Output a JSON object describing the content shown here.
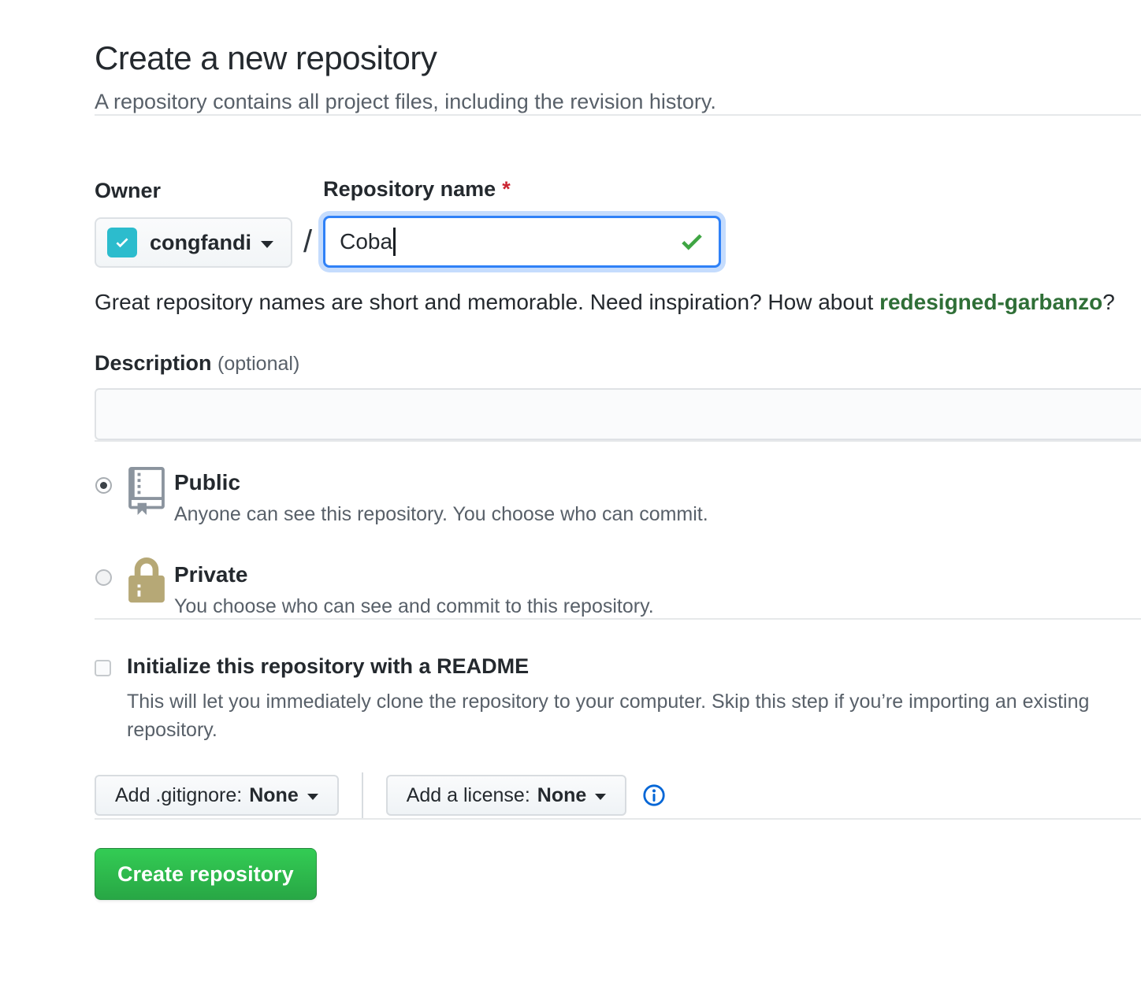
{
  "page": {
    "title": "Create a new repository",
    "subtitle": "A repository contains all project files, including the revision history."
  },
  "owner": {
    "label": "Owner",
    "username": "congfandi",
    "separator": "/"
  },
  "repo_name": {
    "label": "Repository name",
    "required_mark": "*",
    "value": "Coba",
    "valid": true
  },
  "suggestion": {
    "text_before": "Great repository names are short and memorable. Need inspiration? How about ",
    "suggestion_name": "redesigned-garbanzo",
    "text_after": "?"
  },
  "description": {
    "label": "Description",
    "optional_note": "(optional)",
    "value": ""
  },
  "visibility": {
    "public": {
      "label": "Public",
      "description": "Anyone can see this repository. You choose who can commit.",
      "selected": true
    },
    "private": {
      "label": "Private",
      "description": "You choose who can see and commit to this repository.",
      "selected": false
    }
  },
  "readme": {
    "label": "Initialize this repository with a README",
    "description": "This will let you immediately clone the repository to your computer. Skip this step if you’re importing an existing repository.",
    "checked": false
  },
  "options": {
    "gitignore_label": "Add .gitignore:",
    "gitignore_value": "None",
    "license_label": "Add a license:",
    "license_value": "None"
  },
  "actions": {
    "create_label": "Create repository"
  },
  "colors": {
    "accent_button_green_top": "#33cc54",
    "accent_button_green_bottom": "#28a745",
    "avatar_teal": "#2cbccd",
    "lock_icon_gold": "#b6a876",
    "repo_icon_gray": "#8b949e",
    "suggestion_link_green": "#2f6f37",
    "focus_border_blue": "#2f81f7",
    "valid_check_green": "#3fa543",
    "info_icon_blue": "#0366d6",
    "required_red": "#cb2431",
    "text_dark": "#24292e",
    "text_muted": "#586069"
  }
}
